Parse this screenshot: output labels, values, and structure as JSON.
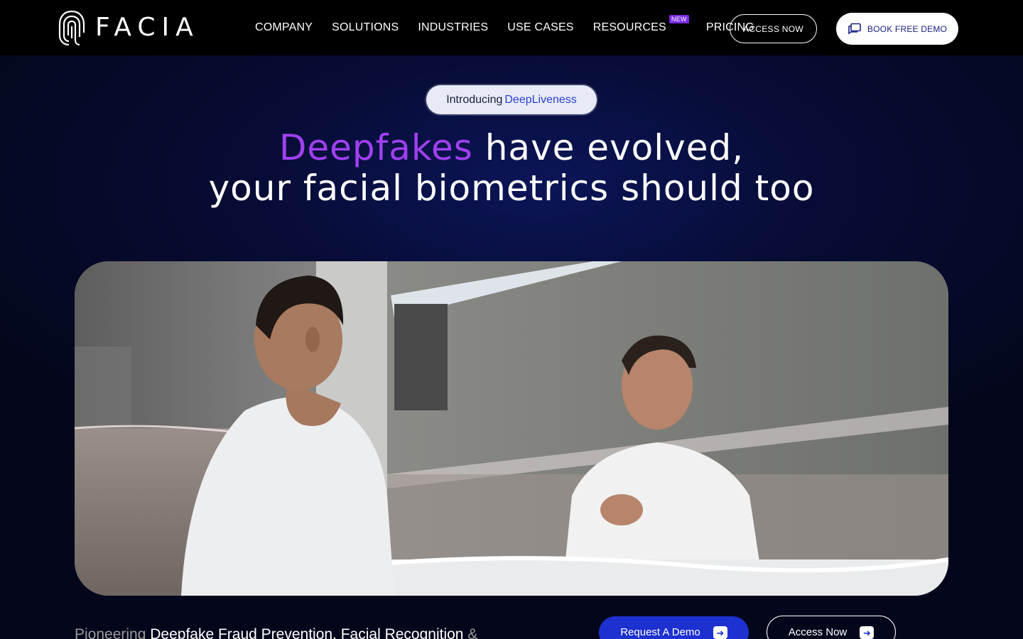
{
  "brand": {
    "name": "FACIA"
  },
  "nav": {
    "items": [
      {
        "label": "COMPANY"
      },
      {
        "label": "SOLUTIONS"
      },
      {
        "label": "INDUSTRIES"
      },
      {
        "label": "USE CASES"
      },
      {
        "label": "RESOURCES",
        "badge": "NEW"
      },
      {
        "label": "PRICING"
      }
    ],
    "access_label": "ACCESS NOW",
    "demo_label": "BOOK FREE DEMO",
    "demo_icon": "chat-icon"
  },
  "hero": {
    "intro_prefix": "Introducing",
    "intro_accent": "DeepLiveness",
    "title_highlight": "Deepfakes",
    "title_rest_line1": " have evolved,",
    "title_line2": "your facial biometrics should too",
    "media_icon": "video-man-mirror"
  },
  "bottom": {
    "tagline_muted": "Pioneering",
    "tagline_main": " Deepfake Fraud Prevention, Facial Recognition",
    "tagline_tail": " &",
    "request_label": "Request A Demo",
    "access_label": "Access Now",
    "arrow_icon": "arrow-right-icon"
  },
  "colors": {
    "accent_purple": "#a040f0",
    "accent_blue": "#1d30d0",
    "nav_bg": "#000000",
    "page_bg": "#04071c"
  }
}
